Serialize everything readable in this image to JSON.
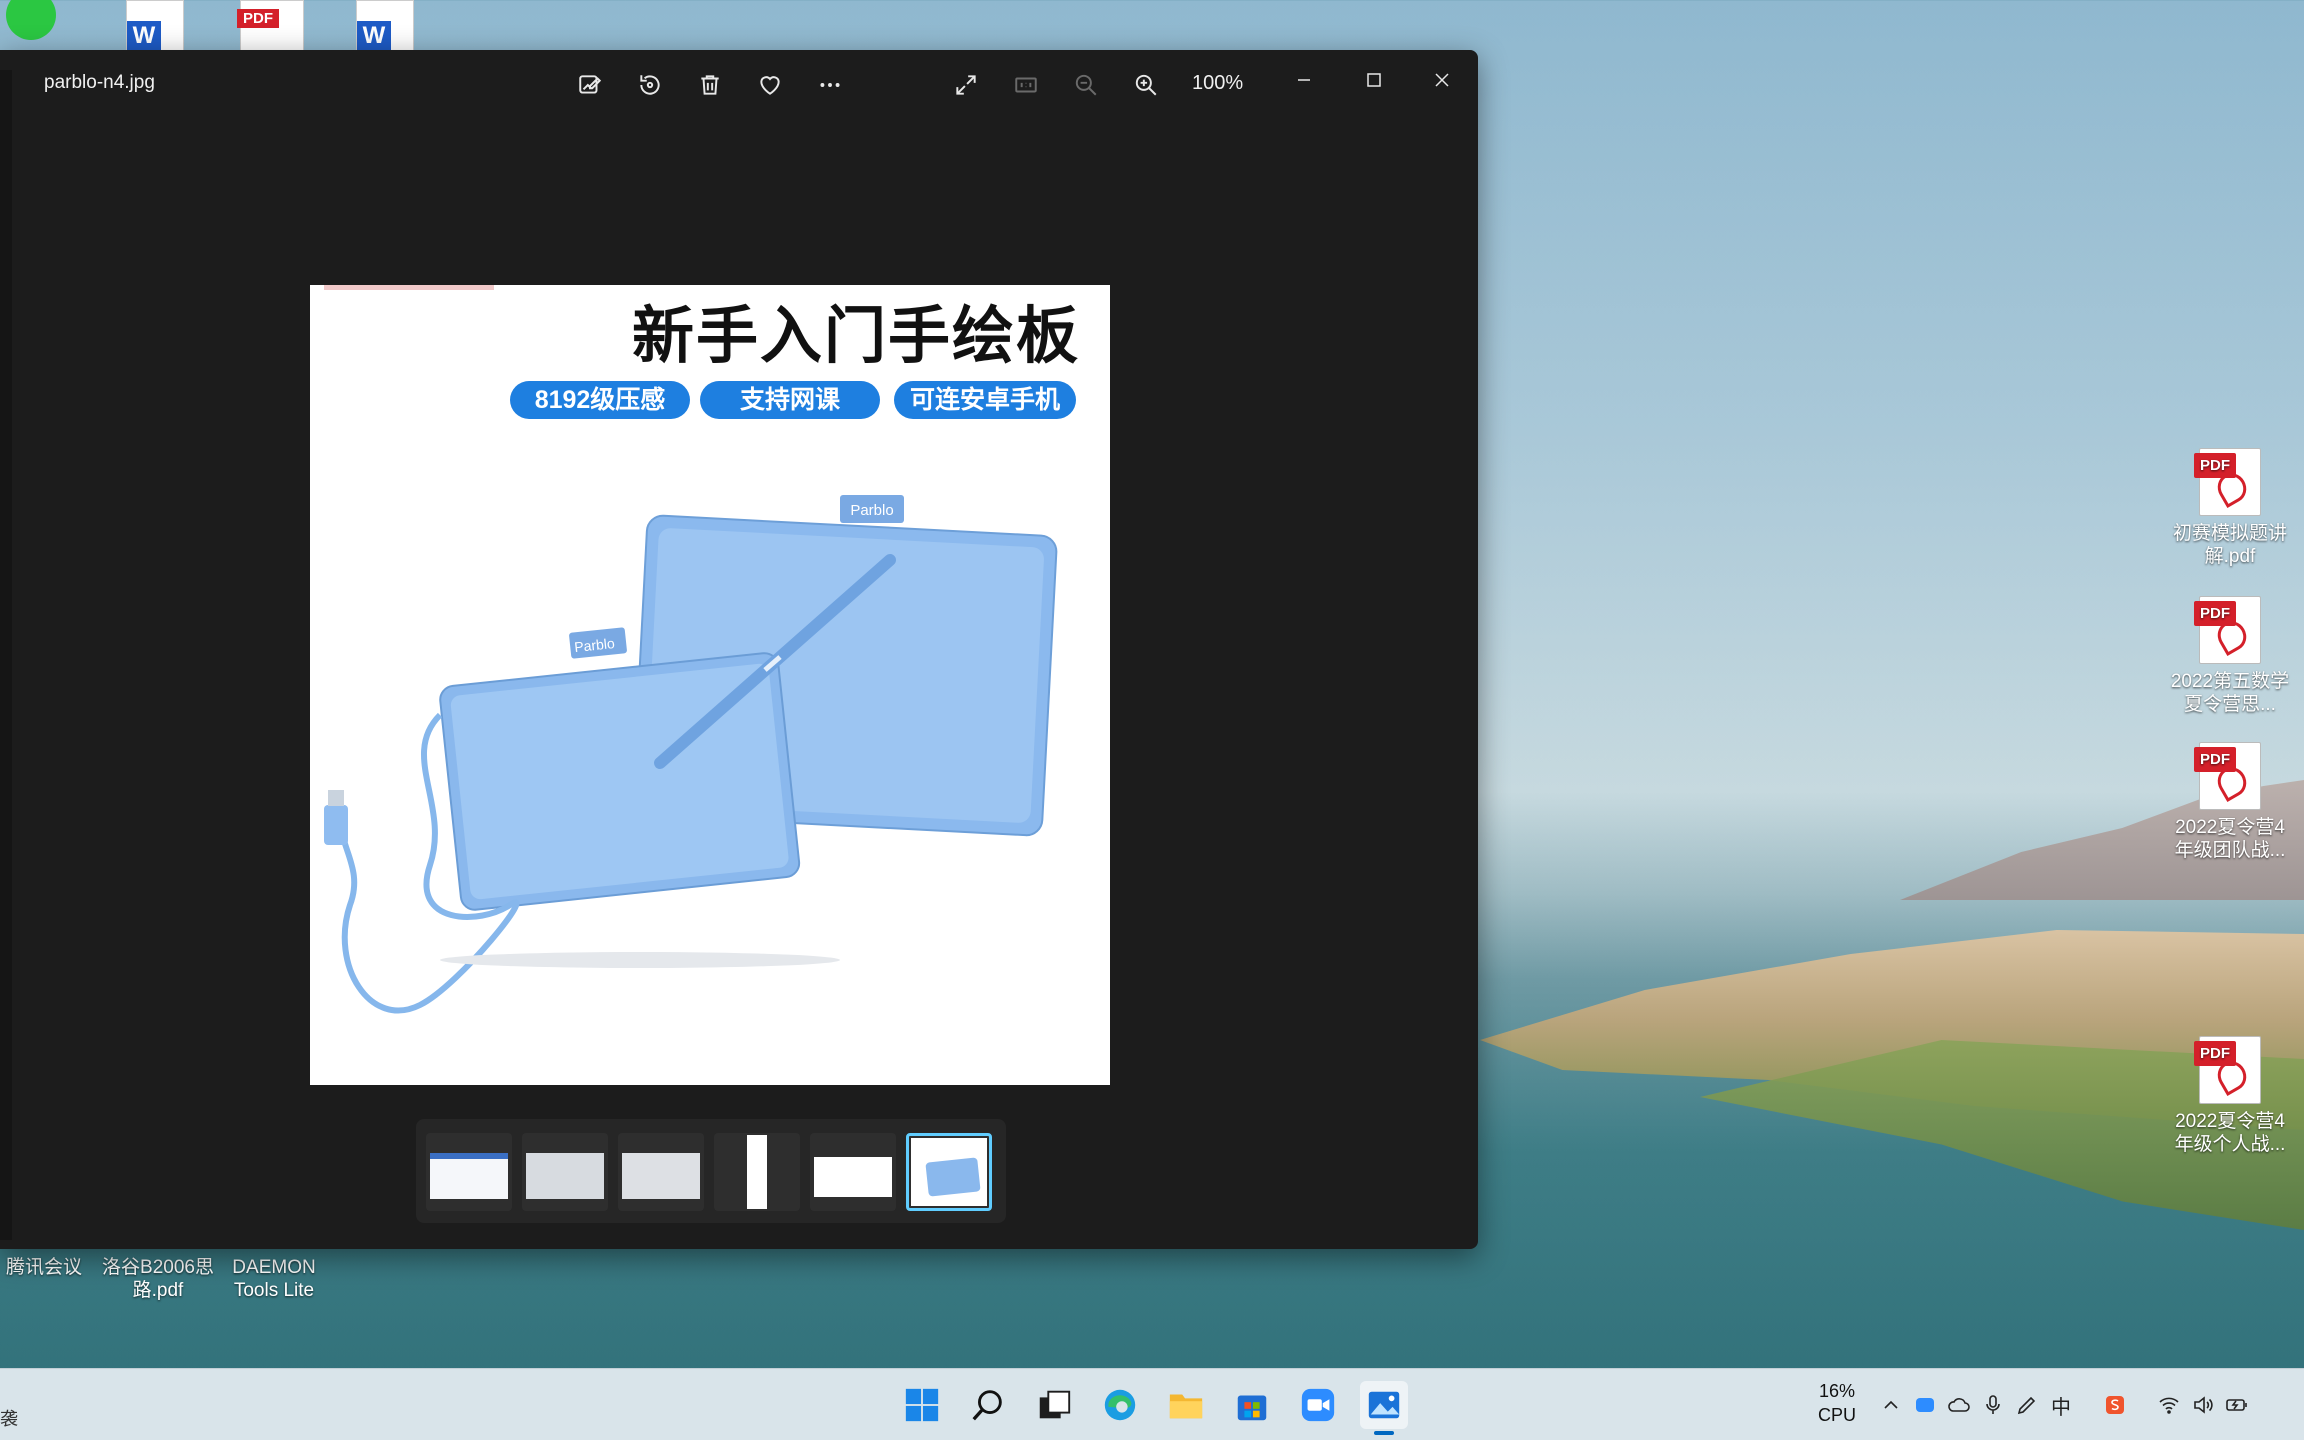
{
  "viewer": {
    "file_name": "parblo-n4.jpg",
    "zoom": "100%",
    "toolbar": {
      "edit": "edit-image-icon",
      "rotate": "rotate-icon",
      "delete": "delete-icon",
      "favorite": "heart-icon",
      "more": "more-icon",
      "fullscreen": "fullscreen-icon",
      "actual_size": "actual-size-icon",
      "zoom_out": "zoom-out-icon",
      "zoom_in": "zoom-in-icon"
    },
    "photo": {
      "title": "新手入门手绘板",
      "badges": [
        "8192级压感",
        "支持网课",
        "可连安卓手机"
      ],
      "brand_label": "Parblo"
    },
    "filmstrip": {
      "selected_index": 5,
      "count": 6
    }
  },
  "desktop": {
    "right_icons": [
      {
        "label": "初赛模拟题讲解.pdf",
        "type": "PDF"
      },
      {
        "label": "2022第五数学夏令营思...",
        "type": "PDF"
      },
      {
        "label": "2022夏令营4年级团队战...",
        "type": "PDF"
      },
      {
        "label": "2022夏令营4年级个人战...",
        "type": "PDF"
      }
    ],
    "bottom_icons": [
      {
        "label": "腾讯会议"
      },
      {
        "label": "洛谷B2006思路.pdf"
      },
      {
        "label": "DAEMON Tools Lite"
      }
    ],
    "pdf_tag": "PDF",
    "word_tag": "W"
  },
  "taskbar": {
    "cpu_percent": "16%",
    "cpu_label": "CPU",
    "ime": "中",
    "left_edge_text": "袭",
    "colors": {
      "accent": "#0067c0",
      "selected_thumb": "#60cdff"
    }
  }
}
